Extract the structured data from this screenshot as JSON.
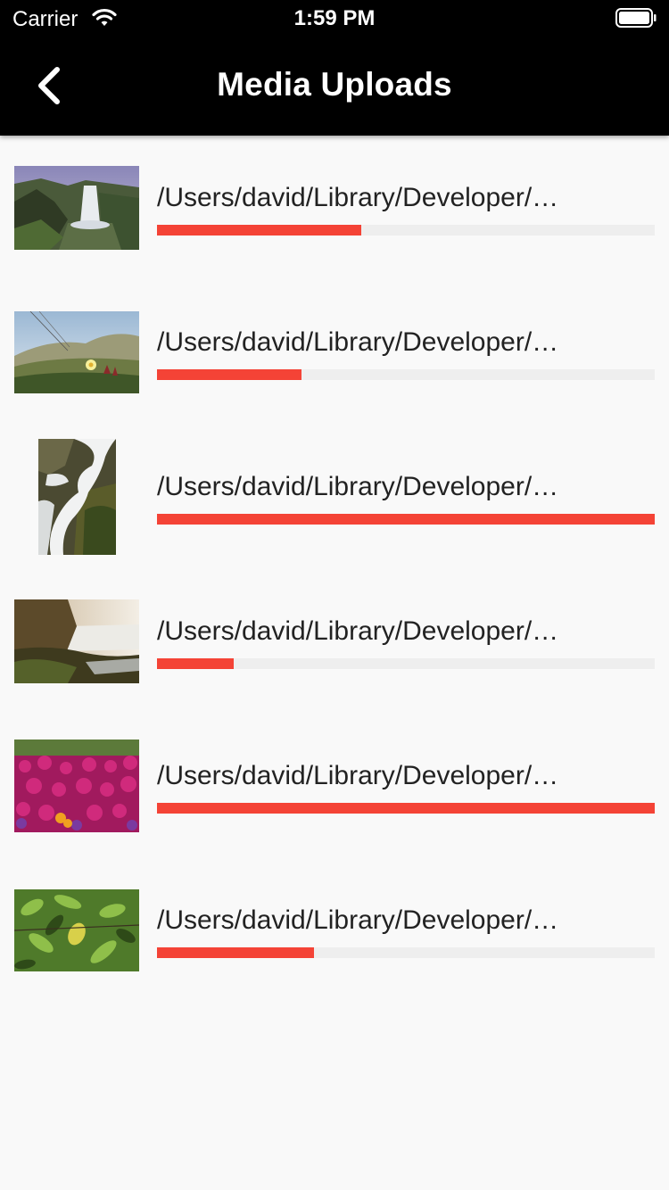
{
  "status_bar": {
    "carrier": "Carrier",
    "time": "1:59 PM"
  },
  "nav": {
    "title": "Media Uploads",
    "back_icon": "chevron-left-icon"
  },
  "colors": {
    "progress_fill": "#f44336",
    "progress_track": "#eeeeee",
    "nav_background": "#000000"
  },
  "uploads": [
    {
      "path": "/Users/david/Library/Developer/…",
      "progress": 0.41,
      "thumb": "waterfall-cliff"
    },
    {
      "path": "/Users/david/Library/Developer/…",
      "progress": 0.29,
      "thumb": "dune-flower"
    },
    {
      "path": "/Users/david/Library/Developer/…",
      "progress": 1.0,
      "thumb": "cascade-rocks"
    },
    {
      "path": "/Users/david/Library/Developer/…",
      "progress": 0.155,
      "thumb": "misty-falls"
    },
    {
      "path": "/Users/david/Library/Developer/…",
      "progress": 1.0,
      "thumb": "magenta-flowers"
    },
    {
      "path": "/Users/david/Library/Developer/…",
      "progress": 0.315,
      "thumb": "green-leaves"
    }
  ]
}
